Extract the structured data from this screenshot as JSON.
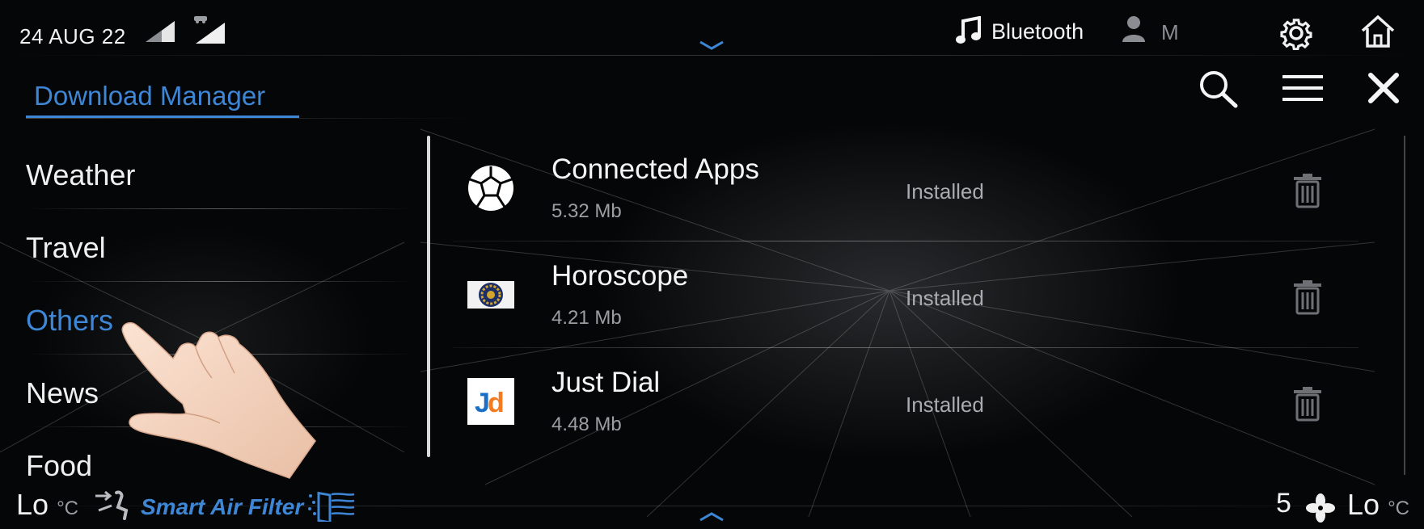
{
  "status_bar": {
    "date": "24 AUG 22",
    "audio_source": "Bluetooth",
    "user_initial": "M",
    "icons": [
      "signal-icon",
      "car-signal-icon",
      "chevron-down-icon",
      "music-note-icon",
      "user-icon",
      "gear-icon",
      "home-icon"
    ]
  },
  "header": {
    "title": "Download Manager",
    "icons": [
      "search-icon",
      "menu-icon",
      "close-icon"
    ]
  },
  "sidebar": {
    "items": [
      {
        "label": "Weather"
      },
      {
        "label": "Travel"
      },
      {
        "label": "Others"
      },
      {
        "label": "News"
      },
      {
        "label": "Food"
      }
    ],
    "selected": "Others"
  },
  "downloads": [
    {
      "name": "Connected Apps",
      "size": "5.32 Mb",
      "status": "Installed",
      "icon": "connected-apps-icon"
    },
    {
      "name": "Horoscope",
      "size": "4.21 Mb",
      "status": "Installed",
      "icon": "horoscope-icon"
    },
    {
      "name": "Just Dial",
      "size": "4.48 Mb",
      "status": "Installed",
      "icon": "just-dial-icon"
    }
  ],
  "just_dial_logo": {
    "j": "J",
    "d": "d"
  },
  "climate": {
    "left_temp": "Lo",
    "left_unit": "°C",
    "smart_air_filter_label": "Smart Air Filter",
    "fan_speed": "5",
    "right_temp": "Lo",
    "right_unit": "°C"
  },
  "colors": {
    "accent": "#3e86d6",
    "background": "#050607",
    "secondary_text": "#9a9ea3"
  }
}
